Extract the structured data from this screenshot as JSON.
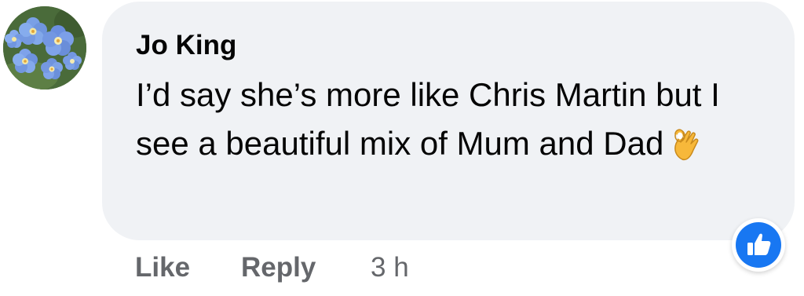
{
  "comment": {
    "author": "Jo King",
    "text": "I’d say she’s more like Chris Martin but I see a beautiful mix of Mum and Dad",
    "emoji": "ok-hand-emoji",
    "avatar": "forget-me-not-flowers"
  },
  "reactions": {
    "icon": "thumbs-up-icon",
    "color": "#1877f2"
  },
  "actions": {
    "like_label": "Like",
    "reply_label": "Reply",
    "timestamp": "3 h"
  },
  "colors": {
    "bubble": "#f0f2f5",
    "text": "#050505",
    "secondary_text": "#65676b"
  }
}
